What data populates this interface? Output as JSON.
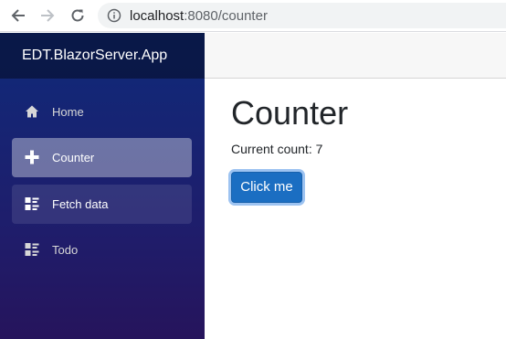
{
  "browser": {
    "url_host": "localhost",
    "url_rest": ":8080/counter"
  },
  "sidebar": {
    "brand": "EDT.BlazorServer.App",
    "items": [
      {
        "label": "Home",
        "icon": "home-icon",
        "state": "normal"
      },
      {
        "label": "Counter",
        "icon": "plus-icon",
        "state": "active"
      },
      {
        "label": "Fetch data",
        "icon": "list-rich-icon",
        "state": "hover"
      },
      {
        "label": "Todo",
        "icon": "list-rich-icon",
        "state": "normal"
      }
    ]
  },
  "main": {
    "title": "Counter",
    "count_prefix": "Current count: ",
    "count_value": "7",
    "button_label": "Click me"
  },
  "colors": {
    "sidebar_top": "#0f2a7a",
    "sidebar_bottom": "#26145c",
    "button": "#1b6ec2",
    "button_focus_ring": "#9dc3f1"
  }
}
